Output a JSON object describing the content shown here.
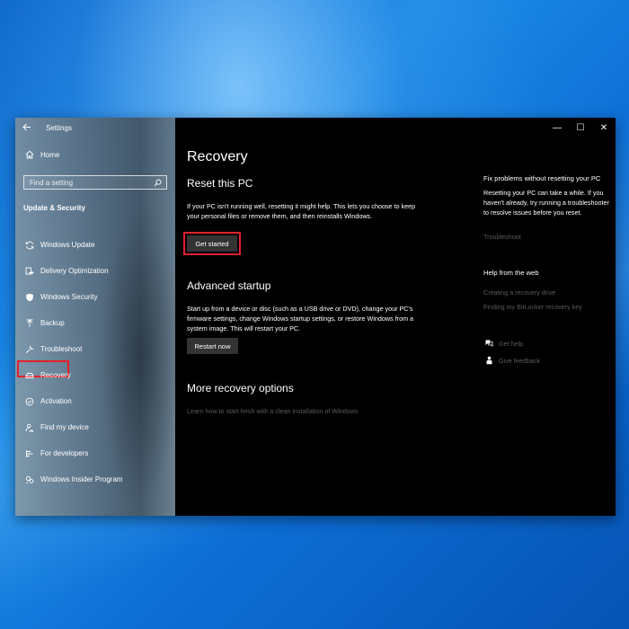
{
  "window": {
    "title": "Settings",
    "controls": [
      "—",
      "☐",
      "✕"
    ]
  },
  "sidebar": {
    "home_label": "Home",
    "search_placeholder": "Find a setting",
    "section_title": "Update & Security",
    "items": [
      {
        "label": "Windows Update",
        "icon": "sync-icon"
      },
      {
        "label": "Delivery Optimization",
        "icon": "delivery-optimization-icon"
      },
      {
        "label": "Windows Security",
        "icon": "shield-icon"
      },
      {
        "label": "Backup",
        "icon": "backup-arrow-icon"
      },
      {
        "label": "Troubleshoot",
        "icon": "wrench-icon"
      },
      {
        "label": "Recovery",
        "icon": "recovery-drive-icon",
        "selected": true
      },
      {
        "label": "Activation",
        "icon": "check-circle-icon"
      },
      {
        "label": "Find my device",
        "icon": "person-locate-icon"
      },
      {
        "label": "For developers",
        "icon": "developer-tools-icon"
      },
      {
        "label": "Windows Insider Program",
        "icon": "insider-icon"
      }
    ]
  },
  "main": {
    "page_title": "Recovery",
    "reset": {
      "title": "Reset this PC",
      "description": "If your PC isn't running well, resetting it might help. This lets you choose to keep your personal files or remove them, and then reinstalls Windows.",
      "button_label": "Get started"
    },
    "advanced": {
      "title": "Advanced startup",
      "description": "Start up from a device or disc (such as a USB drive or DVD), change your PC's firmware settings, change Windows startup settings, or restore Windows from a system image. This will restart your PC.",
      "button_label": "Restart now"
    },
    "more": {
      "title": "More recovery options",
      "link": "Learn how to start fresh with a clean installation of Windows"
    }
  },
  "related": {
    "fix_title": "Fix problems without resetting your PC",
    "fix_text": "Resetting your PC can take a while. If you haven't already, try running a troubleshooter to resolve issues before you reset.",
    "fix_link": "Troubleshoot",
    "web_title": "Help from the web",
    "web_links": [
      "Creating a recovery drive",
      "Finding my BitLocker recovery key"
    ],
    "get_help": "Get help",
    "give_feedback": "Give feedback"
  },
  "colors": {
    "highlight_red": "#e0212c",
    "dim_link": "#5b5b5b",
    "button_bg": "#333333"
  }
}
